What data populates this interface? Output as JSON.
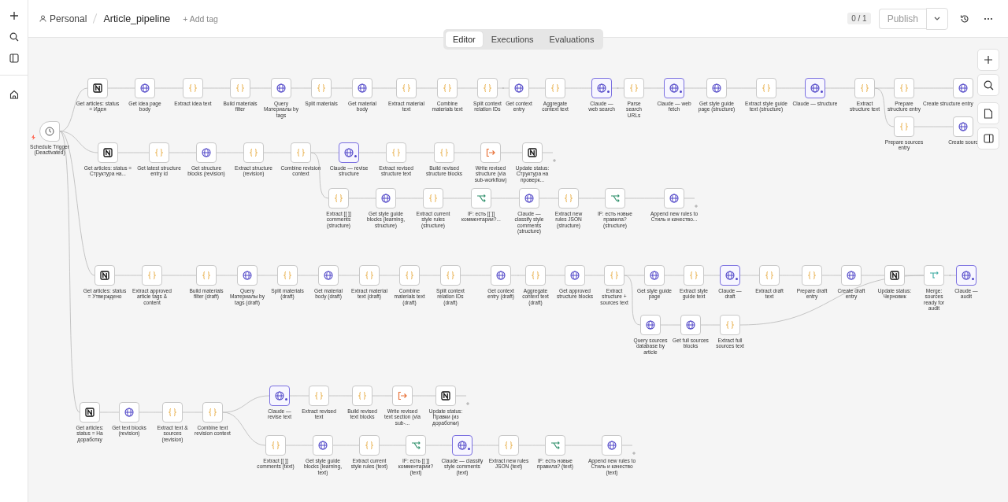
{
  "top_bar": {
    "owner": "Personal",
    "workflow_name": "Article_pipeline",
    "add_tag": "+ Add tag",
    "version_counter": "0 / 1",
    "publish_button": "Publish"
  },
  "tabs": [
    {
      "label": "Editor",
      "selected": true
    },
    {
      "label": "Executions",
      "selected": false
    },
    {
      "label": "Evaluations",
      "selected": false
    }
  ],
  "trigger": {
    "label": "Schedule Trigger (Deactivated)"
  },
  "branches": [
    {
      "nodes": [
        {
          "label": "Get articles: status = Идея",
          "kind": "notion"
        },
        {
          "label": "Get idea page body",
          "kind": "http"
        },
        {
          "label": "Extract idea text",
          "kind": "code"
        },
        {
          "label": "Build materials filter",
          "kind": "code"
        },
        {
          "label": "Query Материалы by tags",
          "kind": "http"
        },
        {
          "label": "Split materials",
          "kind": "code"
        },
        {
          "label": "Get material body",
          "kind": "http"
        },
        {
          "label": "Extract material text",
          "kind": "code"
        },
        {
          "label": "Combine materials text",
          "kind": "code"
        },
        {
          "label": "Split context relation IDs",
          "kind": "code"
        },
        {
          "label": "Get context entry",
          "kind": "http"
        },
        {
          "label": "Aggregate context text",
          "kind": "code"
        },
        {
          "label": "Claude — web search",
          "kind": "ai"
        },
        {
          "label": "Parse search URLs",
          "kind": "code"
        },
        {
          "label": "Claude — web fetch",
          "kind": "ai"
        },
        {
          "label": "Get style guide page (structure)",
          "kind": "http"
        },
        {
          "label": "Extract style guide text (structure)",
          "kind": "code"
        },
        {
          "label": "Claude — structure",
          "kind": "ai"
        },
        {
          "label": "Extract structure text",
          "kind": "code"
        },
        {
          "label": "Prepare structure entry",
          "kind": "code"
        },
        {
          "label": "Create structure entry",
          "kind": "http"
        }
      ]
    },
    {
      "nodes": [
        {
          "label": "Prepare sources entry",
          "kind": "code"
        },
        {
          "label": "Create sourc",
          "kind": "http"
        }
      ]
    },
    {
      "nodes": [
        {
          "label": "Get articles: status = Структура на...",
          "kind": "notion"
        },
        {
          "label": "Get latest structure entry id",
          "kind": "code"
        },
        {
          "label": "Get structure blocks (revision)",
          "kind": "http"
        },
        {
          "label": "Extract structure (revision)",
          "kind": "code"
        },
        {
          "label": "Combine revision context",
          "kind": "code"
        },
        {
          "label": "Claude — revise structure",
          "kind": "ai"
        },
        {
          "label": "Extract revised structure text",
          "kind": "code"
        },
        {
          "label": "Build revised structure blocks",
          "kind": "code"
        },
        {
          "label": "Write revised structure (via sub-workflow)",
          "kind": "subworkflow"
        },
        {
          "label": "Update status: Структура на проверк...",
          "kind": "notion"
        }
      ]
    },
    {
      "nodes": [
        {
          "label": "Extract [[ ]] comments (structure)",
          "kind": "code"
        },
        {
          "label": "Get style guide blocks (learning, structure)",
          "kind": "http"
        },
        {
          "label": "Extract current style rules (structure)",
          "kind": "code"
        },
        {
          "label": "IF: есть [[ ]] комментарии?...",
          "kind": "if"
        },
        {
          "label": "Claude — classify style comments (structure)",
          "kind": "http"
        },
        {
          "label": "Extract new rules JSON (structure)",
          "kind": "code"
        },
        {
          "label": "IF: есть новые правила? (structure)",
          "kind": "if"
        },
        {
          "label": "Append new rules to Стиль и качество...",
          "kind": "http"
        }
      ]
    },
    {
      "nodes": [
        {
          "label": "Get articles: status = Утверждено",
          "kind": "notion"
        },
        {
          "label": "Extract approved article tags & content",
          "kind": "code"
        },
        {
          "label": "Build materials filter (draft)",
          "kind": "code"
        },
        {
          "label": "Query Материалы by tags (draft)",
          "kind": "http"
        },
        {
          "label": "Split materials (draft)",
          "kind": "code"
        },
        {
          "label": "Get material body (draft)",
          "kind": "http"
        },
        {
          "label": "Extract material text (draft)",
          "kind": "code"
        },
        {
          "label": "Combine materials text (draft)",
          "kind": "code"
        },
        {
          "label": "Split context relation IDs (draft)",
          "kind": "code"
        },
        {
          "label": "Get context entry (draft)",
          "kind": "http"
        },
        {
          "label": "Aggregate context text (draft)",
          "kind": "code"
        },
        {
          "label": "Get approved structure blocks",
          "kind": "http"
        },
        {
          "label": "Extract structure + sources text",
          "kind": "code"
        },
        {
          "label": "Get style guide page",
          "kind": "http"
        },
        {
          "label": "Extract style guide text",
          "kind": "code"
        },
        {
          "label": "Claude — draft",
          "kind": "ai"
        },
        {
          "label": "Extract draft text",
          "kind": "code"
        },
        {
          "label": "Prepare draft entry",
          "kind": "code"
        },
        {
          "label": "Create draft entry",
          "kind": "http"
        },
        {
          "label": "Update status: Черновик",
          "kind": "notion"
        },
        {
          "label": "Merge: sources ready for audit",
          "kind": "merge"
        },
        {
          "label": "Claude — audit",
          "kind": "ai"
        }
      ]
    },
    {
      "nodes": [
        {
          "label": "Query sources database by article",
          "kind": "http"
        },
        {
          "label": "Get full sources blocks",
          "kind": "http"
        },
        {
          "label": "Extract full sources text",
          "kind": "code"
        }
      ]
    },
    {
      "nodes": [
        {
          "label": "Get articles: status = На доработку",
          "kind": "notion"
        },
        {
          "label": "Get text blocks (revision)",
          "kind": "http"
        },
        {
          "label": "Extract text & sources (revision)",
          "kind": "code"
        },
        {
          "label": "Combine text revision context",
          "kind": "code"
        }
      ]
    },
    {
      "nodes": [
        {
          "label": "Claude — revise text",
          "kind": "ai"
        },
        {
          "label": "Extract revised text",
          "kind": "code"
        },
        {
          "label": "Build revised text blocks",
          "kind": "code"
        },
        {
          "label": "Write revised text section (via sub-...",
          "kind": "subworkflow"
        },
        {
          "label": "Update status: Правки (из доработки)",
          "kind": "notion"
        }
      ]
    },
    {
      "nodes": [
        {
          "label": "Extract [[ ]] comments (text)",
          "kind": "code"
        },
        {
          "label": "Get style guide blocks (learning, text)",
          "kind": "http"
        },
        {
          "label": "Extract current style rules (text)",
          "kind": "code"
        },
        {
          "label": "IF: есть [[ ]] комментарии? (text)",
          "kind": "if"
        },
        {
          "label": "Claude — classify style comments (text)",
          "kind": "ai"
        },
        {
          "label": "Extract new rules JSON (text)",
          "kind": "code"
        },
        {
          "label": "IF: есть новые правила? (text)",
          "kind": "if"
        },
        {
          "label": "Append new rules to Стиль и качество (text)",
          "kind": "http"
        }
      ]
    }
  ]
}
